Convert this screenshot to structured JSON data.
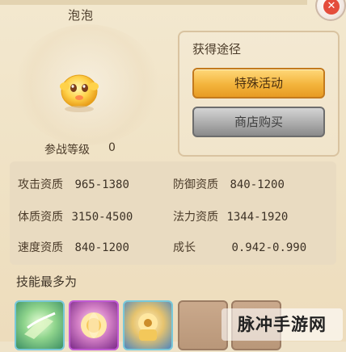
{
  "pet": {
    "name": "泡泡",
    "battle_level_label": "参战等级",
    "battle_level_value": "0"
  },
  "acquisition": {
    "title": "获得途径",
    "special_event_label": "特殊活动",
    "shop_buy_label": "商店购买"
  },
  "stats": [
    {
      "label": "攻击资质",
      "value": "965-1380"
    },
    {
      "label": "防御资质",
      "value": "840-1200"
    },
    {
      "label": "体质资质",
      "value": "3150-4500"
    },
    {
      "label": "法力资质",
      "value": "1344-1920"
    },
    {
      "label": "速度资质",
      "value": "840-1200"
    },
    {
      "label": "成长",
      "value": "0.942-0.990"
    }
  ],
  "skills": {
    "title": "技能最多为"
  },
  "watermark": "脉冲手游网",
  "colors": {
    "accent_gold": "#f3b43c",
    "gray_button": "#a8a8a8",
    "close_red": "#e44c3c"
  }
}
